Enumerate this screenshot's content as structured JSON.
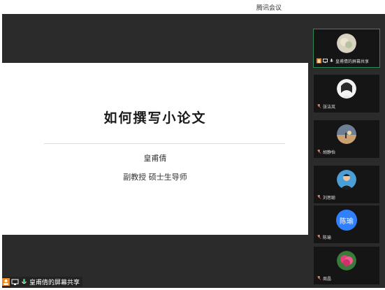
{
  "window": {
    "title": "腾讯会议"
  },
  "slide": {
    "title": "如何撰写小论文",
    "author": "皇甫倩",
    "role": "副教授  硕士生导师"
  },
  "participants": [
    {
      "name": "皇甫倩的屏幕共享",
      "avatar": "flower-photo",
      "active": true
    },
    {
      "name": "张洁岚",
      "avatar": "woman-photo"
    },
    {
      "name": "胡静怡",
      "avatar": "landscape-photo"
    },
    {
      "name": "刘思聪",
      "avatar": "man-photo"
    },
    {
      "name": "陈瑜",
      "avatar": "text-avatar",
      "avatar_text": "陈瑜"
    },
    {
      "name": "周晶",
      "avatar": "pink-flower-photo"
    }
  ],
  "share_status": {
    "label": "皇甫倩的屏幕共享"
  },
  "colors": {
    "stage": "#2b2b2b",
    "accent_blue": "#2f80ff",
    "active_outline": "#2e8b57",
    "share_orange": "#f08c1d"
  }
}
